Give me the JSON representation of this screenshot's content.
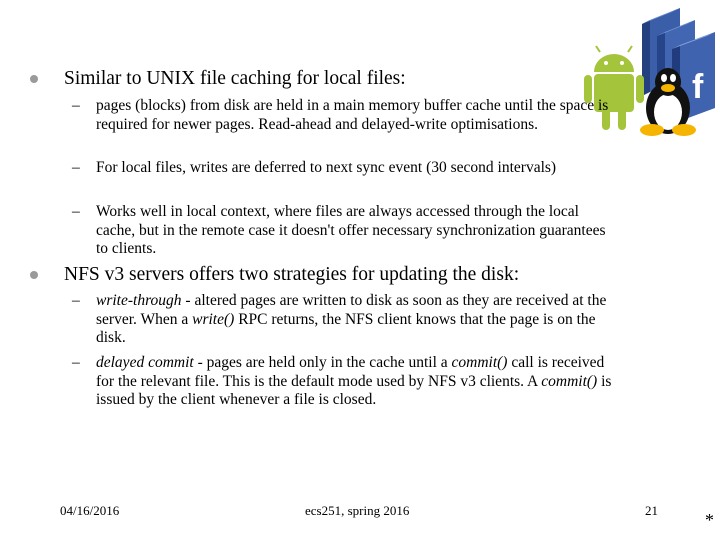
{
  "bullets": [
    {
      "text": "Similar to UNIX file caching for local files:",
      "subs": [
        {
          "parts": [
            {
              "t": "pages (blocks) from disk are held in a main memory buffer cache until the space is required for newer pages. Read-ahead and delayed-write optimisations."
            }
          ]
        },
        {
          "parts": [
            {
              "t": "For local files, writes are deferred to next sync event (30 second intervals)"
            }
          ]
        },
        {
          "parts": [
            {
              "t": "Works well in local context, where files are always accessed through the local cache, but in the remote case it doesn't offer necessary synchronization guarantees to clients."
            }
          ]
        }
      ]
    },
    {
      "text": "NFS v3 servers offers two strategies for updating the disk:",
      "subs": [
        {
          "parts": [
            {
              "t": "write-through",
              "i": true
            },
            {
              "t": " - altered pages are written to disk as soon as they are received at the server. When a "
            },
            {
              "t": "write()",
              "i": true
            },
            {
              "t": " RPC returns, the NFS client knows that the page is on the disk."
            }
          ]
        },
        {
          "parts": [
            {
              "t": "delayed commit",
              "i": true
            },
            {
              "t": " - pages are held only in the cache until a "
            },
            {
              "t": "commit()",
              "i": true
            },
            {
              "t": " call is received for the relevant file. This is the default mode used by NFS v3 clients. A "
            },
            {
              "t": "commit()",
              "i": true
            },
            {
              "t": " is issued by the client whenever a file is closed."
            }
          ]
        }
      ]
    }
  ],
  "footer": {
    "date": "04/16/2016",
    "course": "ecs251, spring 2016",
    "page": "21",
    "mark": "*"
  },
  "icons": [
    "android-icon",
    "linux-tux-icon",
    "facebook-icon"
  ]
}
